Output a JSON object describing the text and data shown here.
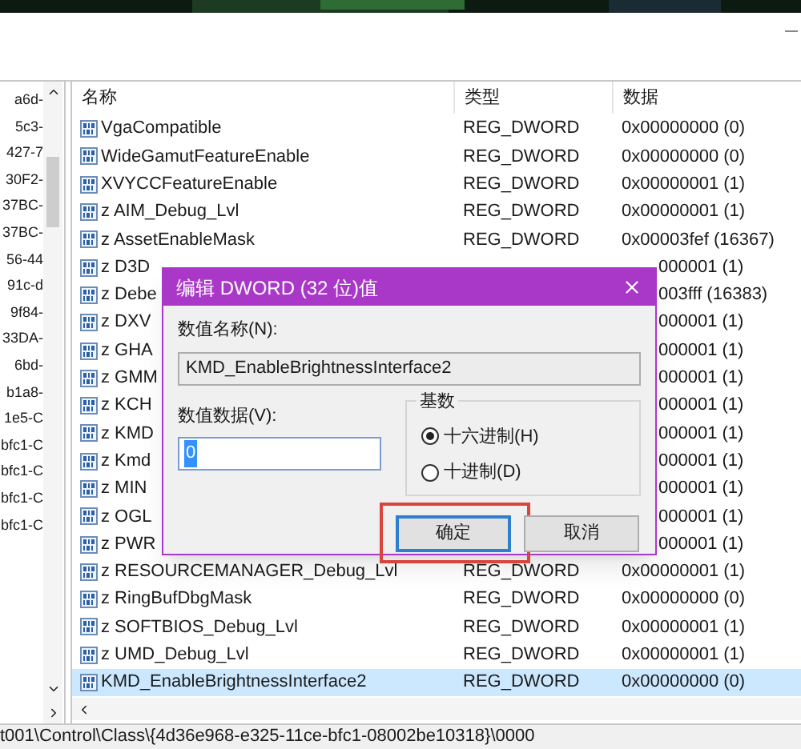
{
  "tree": {
    "items": [
      "a6d-",
      "5c3-",
      "427-7",
      "30F2-",
      "37BC-",
      "37BC-",
      "56-44",
      "91c-d",
      "9f84-",
      "33DA-",
      "6bd-",
      "b1a8-",
      "1e5-C",
      "bfc1-C",
      "bfc1-C",
      "bfc1-C",
      "bfc1-C"
    ]
  },
  "list": {
    "columns": [
      "名称",
      "类型",
      "数据"
    ],
    "rows": [
      {
        "kind": "full",
        "name": "VgaCompatible",
        "type": "REG_DWORD",
        "data": "0x00000000 (0)",
        "selected": false
      },
      {
        "kind": "full",
        "name": "WideGamutFeatureEnable",
        "type": "REG_DWORD",
        "data": "0x00000000 (0)",
        "selected": false
      },
      {
        "kind": "full",
        "name": "XVYCCFeatureEnable",
        "type": "REG_DWORD",
        "data": "0x00000001 (1)",
        "selected": false
      },
      {
        "kind": "full",
        "name": "z AIM_Debug_Lvl",
        "type": "REG_DWORD",
        "data": "0x00000001 (1)",
        "selected": false
      },
      {
        "kind": "full",
        "name": "z AssetEnableMask",
        "type": "REG_DWORD",
        "data": "0x00003fef (16367)",
        "selected": false
      },
      {
        "kind": "covered",
        "name": "z D3D",
        "data": "000001 (1)",
        "selected": false
      },
      {
        "kind": "covered",
        "name": "z Debe",
        "data": "003fff (16383)",
        "selected": false
      },
      {
        "kind": "covered",
        "name": "z DXV",
        "data": "000001 (1)",
        "selected": false
      },
      {
        "kind": "covered",
        "name": "z GHA",
        "data": "000001 (1)",
        "selected": false
      },
      {
        "kind": "covered",
        "name": "z GMM",
        "data": "000001 (1)",
        "selected": false
      },
      {
        "kind": "covered",
        "name": "z KCH",
        "data": "000001 (1)",
        "selected": false
      },
      {
        "kind": "covered",
        "name": "z KMD",
        "data": "000001 (1)",
        "selected": false
      },
      {
        "kind": "covered",
        "name": "z Kmd",
        "data": "000001 (1)",
        "selected": false
      },
      {
        "kind": "covered",
        "name": "z MIN",
        "data": "000001 (1)",
        "selected": false
      },
      {
        "kind": "covered",
        "name": "z OGL",
        "data": "000001 (1)",
        "selected": false
      },
      {
        "kind": "covered",
        "name": "z PWR",
        "data": "000001 (1)",
        "selected": false
      },
      {
        "kind": "full",
        "name": "z RESOURCEMANAGER_Debug_Lvl",
        "type": "REG_DWORD",
        "data": "0x00000001 (1)",
        "selected": false
      },
      {
        "kind": "full",
        "name": "z RingBufDbgMask",
        "type": "REG_DWORD",
        "data": "0x00000000 (0)",
        "selected": false
      },
      {
        "kind": "full",
        "name": "z SOFTBIOS_Debug_Lvl",
        "type": "REG_DWORD",
        "data": "0x00000001 (1)",
        "selected": false
      },
      {
        "kind": "full",
        "name": "z UMD_Debug_Lvl",
        "type": "REG_DWORD",
        "data": "0x00000001 (1)",
        "selected": false
      },
      {
        "kind": "full",
        "name": "KMD_EnableBrightnessInterface2",
        "type": "REG_DWORD",
        "data": "0x00000000 (0)",
        "selected": true
      }
    ]
  },
  "status_bar": "t001\\Control\\Class\\{4d36e968-e325-11ce-bfc1-08002be10318}\\0000",
  "dialog": {
    "title": "编辑 DWORD (32 位)值",
    "name_label": "数值名称(N):",
    "name_value": "KMD_EnableBrightnessInterface2",
    "data_label": "数值数据(V):",
    "data_value": "0",
    "base": {
      "title": "基数",
      "options": [
        {
          "label": "十六进制(H)",
          "selected": true
        },
        {
          "label": "十进制(D)",
          "selected": false
        }
      ]
    },
    "buttons": [
      {
        "label": "确定",
        "focused": true,
        "highlighted": true
      },
      {
        "label": "取消",
        "focused": false,
        "highlighted": false
      }
    ]
  }
}
